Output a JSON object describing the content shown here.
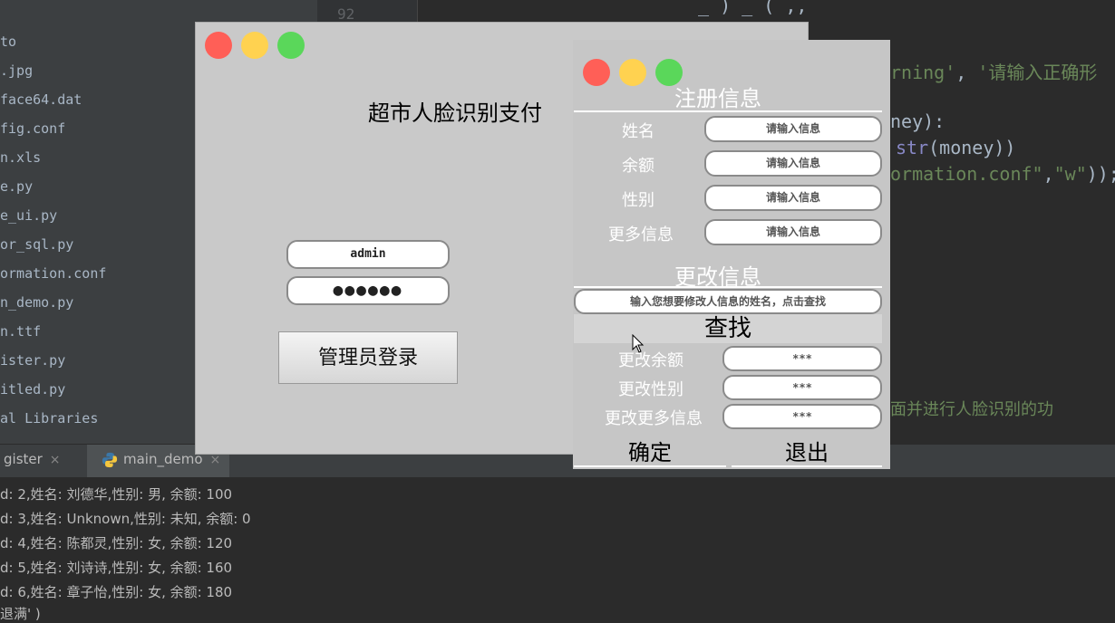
{
  "ide": {
    "line_number": "92",
    "code_top": "_ ) _ (          ,,",
    "files": [
      "to",
      ".jpg",
      "face64.dat",
      "fig.conf",
      "n.xls",
      "e.py",
      "e_ui.py",
      "or_sql.py",
      "ormation.conf",
      "n_demo.py",
      "n.ttf",
      "ister.py",
      "itled.py",
      "al Libraries"
    ],
    "code": {
      "l1_green_a": "rning'",
      "l1_text": ", ",
      "l1_green_b": "'请输入正确形",
      "l2": "ney):",
      "l3_purple": "str",
      "l3_text": "(money))",
      "l4_green_a": "ormation.conf\"",
      "l4_text": ",",
      "l4_green_b": "\"w\"",
      "l4_end": "));",
      "comment": "面并进行人脸识别的功"
    },
    "tabs": [
      {
        "label": "gister",
        "close": "×"
      },
      {
        "label": "main_demo",
        "close": "×"
      }
    ],
    "console": [
      "d: 2,姓名: 刘德华,性别: 男, 余额: 100",
      "d: 3,姓名: Unknown,性别: 未知, 余额: 0",
      "d: 4,姓名: 陈都灵,性别: 女, 余额: 120",
      "d: 5,姓名: 刘诗诗,性别: 女, 余额: 160",
      "d: 6,姓名: 章子怡,性别: 女, 余额: 180",
      "退满' )"
    ]
  },
  "login": {
    "title": "超市人脸识别支付",
    "username": "admin",
    "password_mask": "●●●●●●",
    "login_button": "管理员登录"
  },
  "register": {
    "register_title": "注册信息",
    "fields": [
      {
        "label": "姓名",
        "placeholder": "请输入信息"
      },
      {
        "label": "余额",
        "placeholder": "请输入信息"
      },
      {
        "label": "性别",
        "placeholder": "请输入信息"
      },
      {
        "label": "更多信息",
        "placeholder": "请输入信息"
      }
    ],
    "modify_title": "更改信息",
    "search_placeholder": "输入您想要修改人信息的姓名，点击查找",
    "find_button": "查找",
    "modify_fields": [
      {
        "label": "更改余额",
        "value": "***"
      },
      {
        "label": "更改性别",
        "value": "***"
      },
      {
        "label": "更改更多信息",
        "value": "***"
      }
    ],
    "confirm_button": "确定",
    "exit_button": "退出"
  },
  "colors": {
    "traffic_red": "#ff5f57",
    "traffic_yellow": "#ffd250",
    "traffic_green": "#5ad75a"
  }
}
